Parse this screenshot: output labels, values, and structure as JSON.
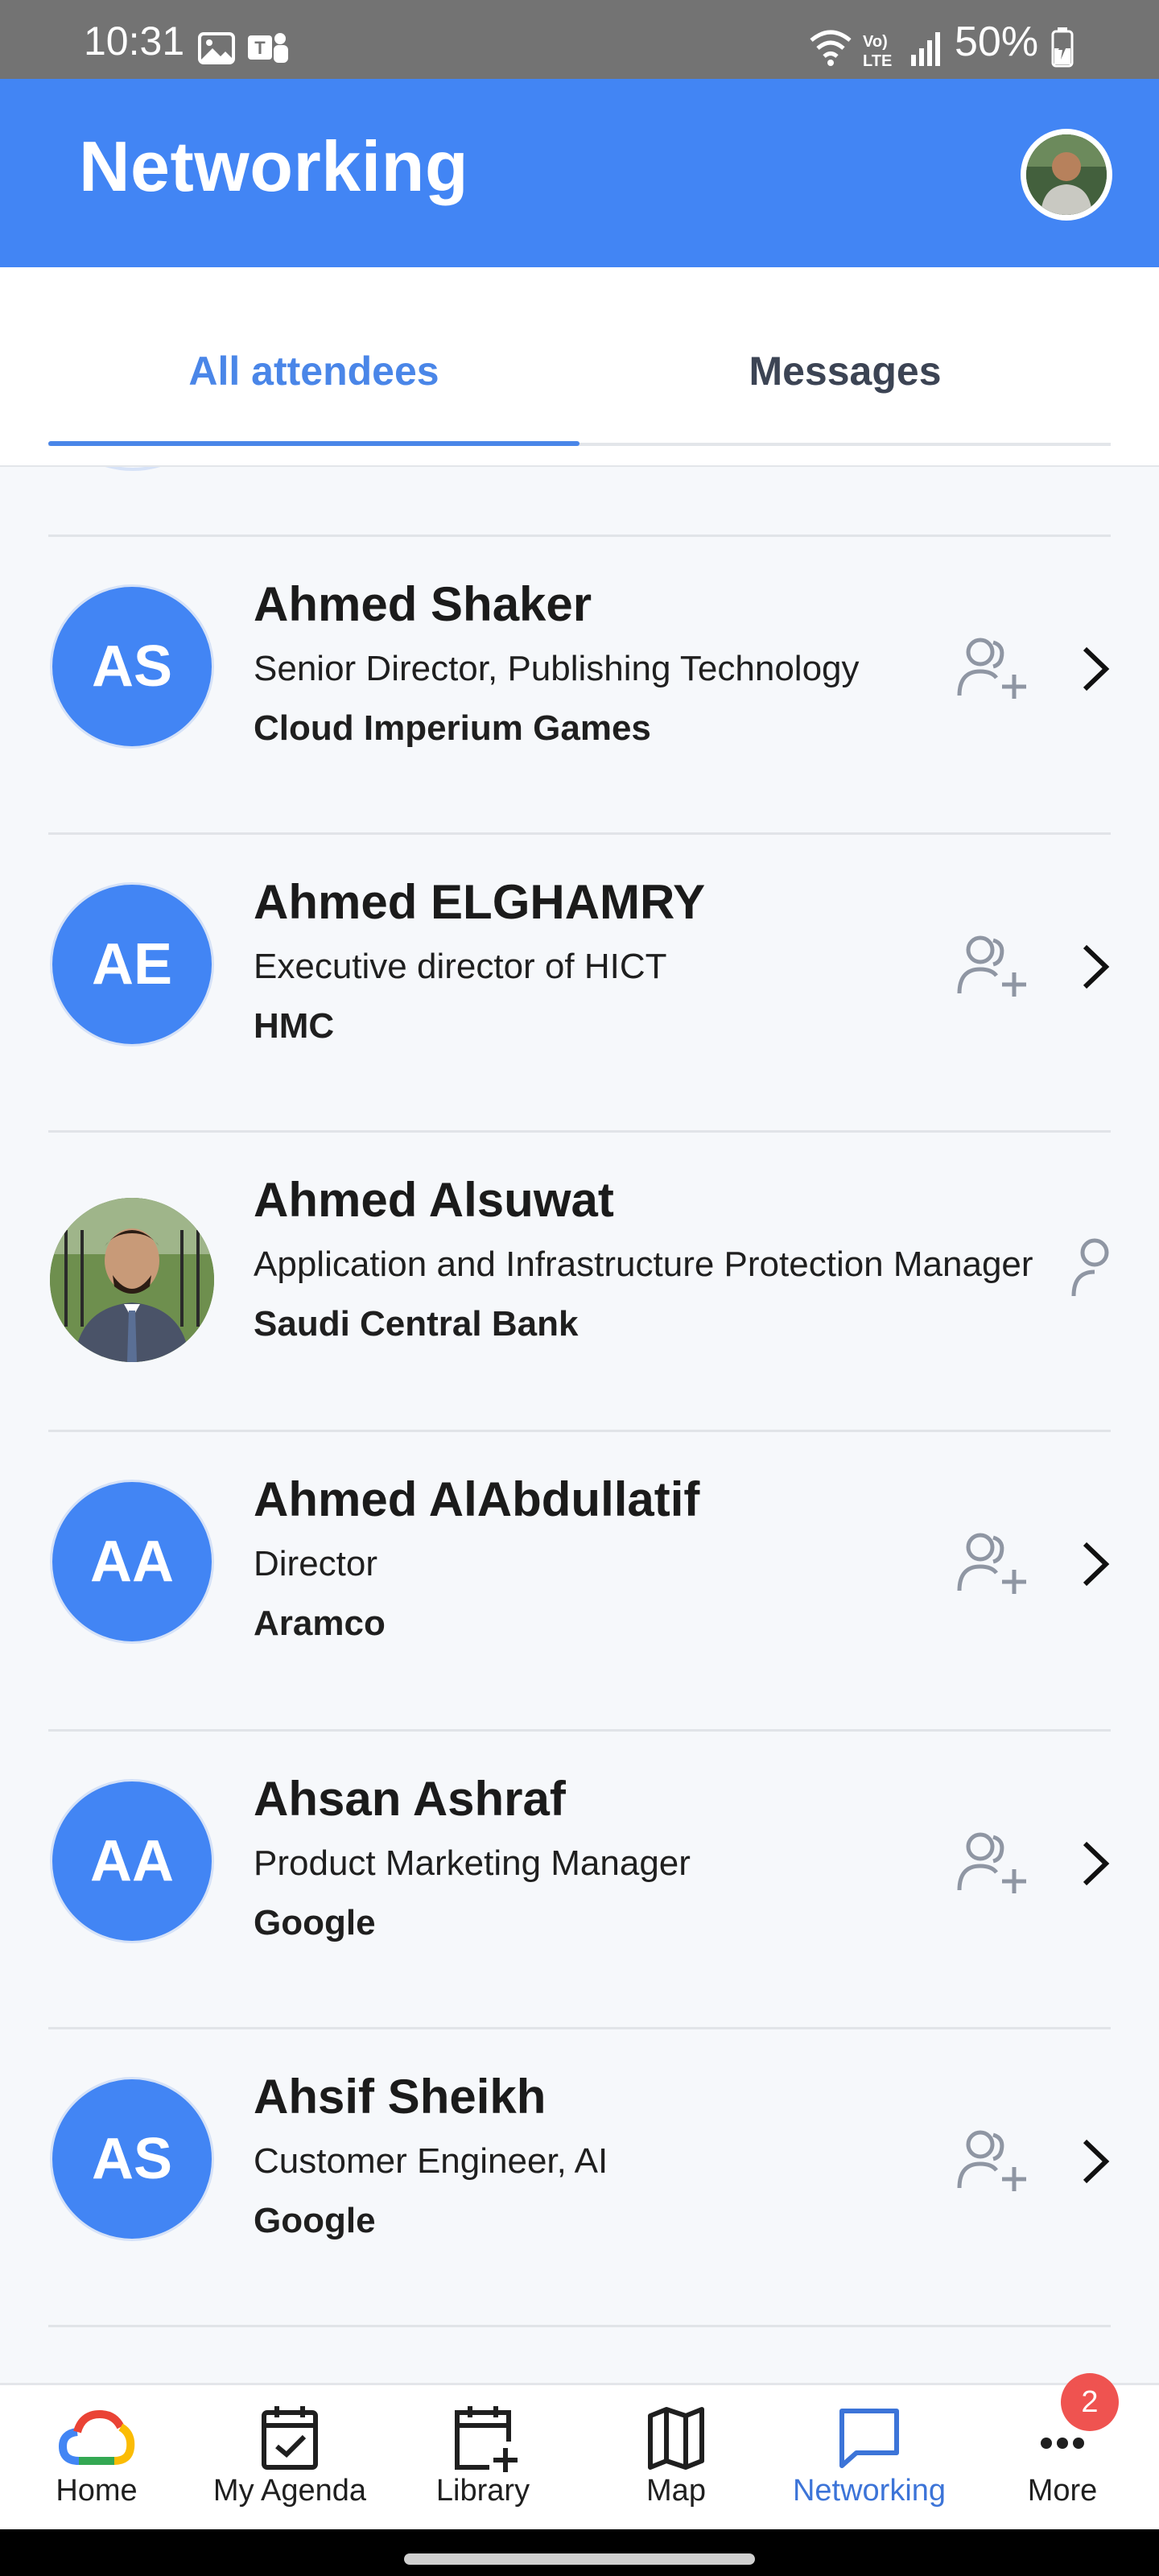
{
  "status_bar": {
    "time": "10:31",
    "battery": "50%",
    "network": "LTE"
  },
  "app_bar": {
    "title": "Networking"
  },
  "tabs": [
    {
      "label": "All attendees",
      "active": true
    },
    {
      "label": "Messages",
      "active": false
    }
  ],
  "attendees": [
    {
      "initials": "AS",
      "name": "Ahmed Shaker",
      "title": "Senior Director, Publishing Technology",
      "company": "Cloud Imperium Games",
      "has_photo": false
    },
    {
      "initials": "AE",
      "name": "Ahmed ELGHAMRY",
      "title": "Executive director of HICT",
      "company": "HMC",
      "has_photo": false
    },
    {
      "initials": "",
      "name": "Ahmed Alsuwat",
      "title": "Application and Infrastructure Protection Manager",
      "company": "Saudi Central Bank",
      "has_photo": true
    },
    {
      "initials": "AA",
      "name": "Ahmed AlAbdullatif",
      "title": "Director",
      "company": "Aramco",
      "has_photo": false
    },
    {
      "initials": "AA",
      "name": "Ahsan Ashraf",
      "title": "Product Marketing Manager",
      "company": "Google",
      "has_photo": false
    },
    {
      "initials": "AS",
      "name": "Ahsif Sheikh",
      "title": "Customer Engineer, AI",
      "company": "Google",
      "has_photo": false
    }
  ],
  "bottom_nav": {
    "items": [
      {
        "label": "Home",
        "icon": "google-cloud-icon"
      },
      {
        "label": "My Agenda",
        "icon": "calendar-check-icon"
      },
      {
        "label": "Library",
        "icon": "calendar-add-icon"
      },
      {
        "label": "Map",
        "icon": "map-icon"
      },
      {
        "label": "Networking",
        "icon": "chat-icon",
        "active": true
      },
      {
        "label": "More",
        "icon": "more-icon"
      }
    ],
    "more_badge": "2"
  },
  "colors": {
    "primary": "#4285f4",
    "active_tab": "#4a86e8",
    "badge": "#ef5350"
  }
}
